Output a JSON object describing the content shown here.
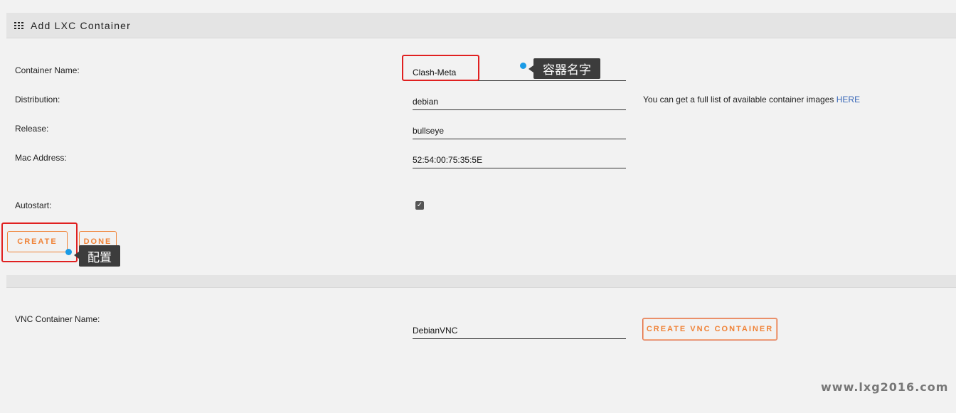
{
  "panel": {
    "title": "Add LXC Container"
  },
  "form": {
    "container_name": {
      "label": "Container Name:",
      "value": "Clash-Meta"
    },
    "distribution": {
      "label": "Distribution:",
      "value": "debian"
    },
    "release": {
      "label": "Release:",
      "value": "bullseye"
    },
    "mac_address": {
      "label": "Mac Address:",
      "value": "52:54:00:75:35:5E"
    },
    "autostart": {
      "label": "Autostart:",
      "checked": true
    },
    "help_text": "You can get a full list of available container images ",
    "help_link": "HERE"
  },
  "buttons": {
    "create": "CREATE",
    "done": "DONE"
  },
  "vnc": {
    "label": "VNC Container Name:",
    "value": "DebianVNC",
    "button": "CREATE VNC CONTAINER"
  },
  "annotations": {
    "name_tip": "容器名字",
    "create_tip": "配置"
  },
  "watermark": "www.lxg2016.com",
  "colors": {
    "accent": "#f08236",
    "highlight": "#e02020",
    "marker": "#1a9be6",
    "link": "#3a68b8"
  }
}
